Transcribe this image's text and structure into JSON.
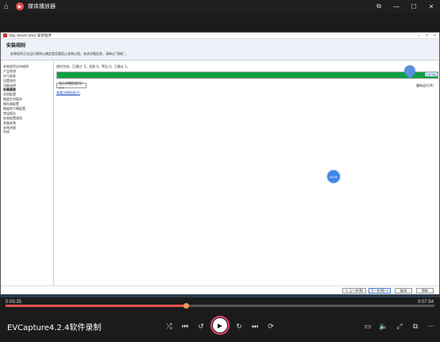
{
  "player": {
    "title": "媒体播放器",
    "media_title": "EVCapture4.2.4软件录制",
    "time_current": "0:05:35",
    "time_total": "0:07:54",
    "progress_fraction": 0.42,
    "window_controls": {
      "minimize": "—",
      "maximize": "☐",
      "close": "✕"
    },
    "extra_controls": {
      "pin": "⧉"
    }
  },
  "installer": {
    "window_title": "SQL Server 2012 安装程序",
    "header_title": "安装规则",
    "header_subtitle": "安装程序正在运行规则以确定是否要阻止安装过程。有关详细信息，请单击“帮助”。",
    "steps": [
      "安装程序支持规则",
      "产品密钥",
      "许可条款",
      "设置角色",
      "功能选择",
      "安装规则",
      "实例配置",
      "磁盘空间要求",
      "服务器配置",
      "数据库引擎配置",
      "错误报告",
      "安装配置规则",
      "准备安装",
      "安装进度",
      "完成"
    ],
    "active_step": 5,
    "operation_text": "操作完成。已通过: 5。失败 0。警告 0。已跳过 1。",
    "progress_fill": 1.0,
    "show_details_label": "显示详细信息(S) >>",
    "view_report_link": "查看详细报表(V)",
    "rerun_label": "重新运行(R)",
    "marker_badge": "4.5 V/s",
    "cursor_bubble": "00:00",
    "footer_buttons": {
      "back": "< 上一步(B)",
      "next": "下一步(N) >",
      "cancel": "取消",
      "help": "帮助"
    }
  }
}
